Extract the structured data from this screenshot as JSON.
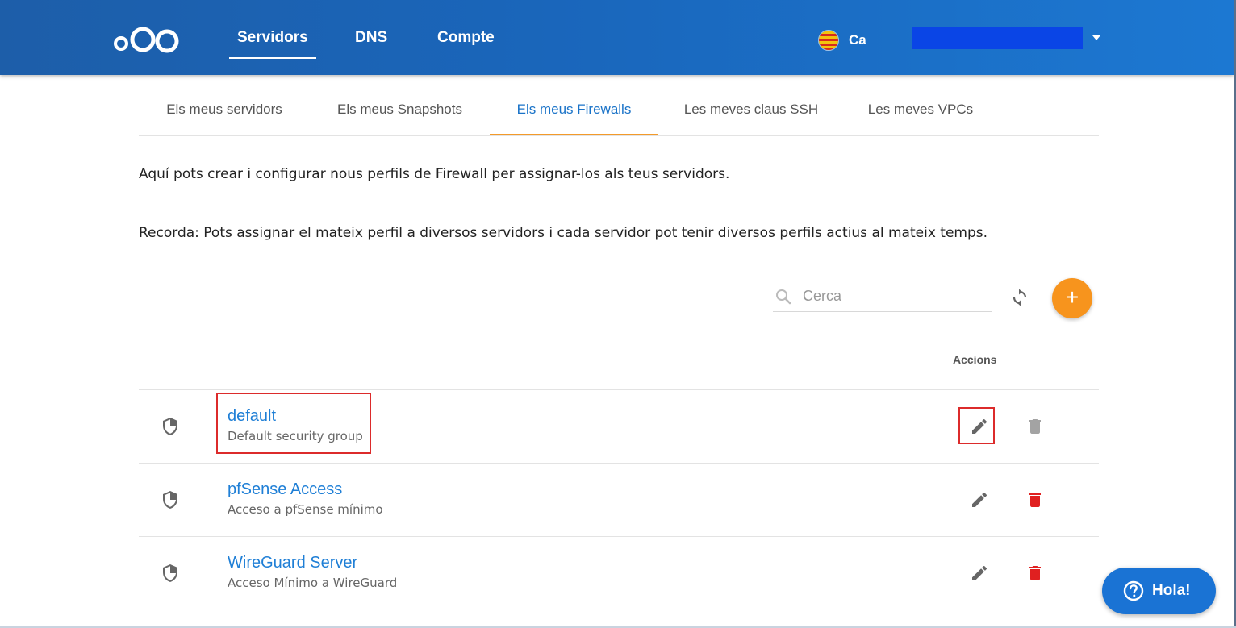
{
  "header": {
    "nav": [
      "Servidors",
      "DNS",
      "Compte"
    ],
    "language": "Ca",
    "colors": {
      "bar": "#1a66bb",
      "user_redaction": "#0a45e6"
    }
  },
  "tabs": [
    "Els meus servidors",
    "Els meus Snapshots",
    "Els meus Firewalls",
    "Les meves claus SSH",
    "Les meves VPCs"
  ],
  "active_tab": "Els meus Firewalls",
  "intro": {
    "line1": "Aquí pots crear i configurar nous perfils de Firewall per assignar-los als teus servidors.",
    "line2": "Recorda: Pots assignar el mateix perfil a diversos servidors i cada servidor pot tenir diversos perfils actius al mateix temps."
  },
  "search": {
    "placeholder": "Cerca",
    "value": ""
  },
  "table": {
    "actions_header": "Accions",
    "rows": [
      {
        "name": "default",
        "description": "Default security group",
        "delete_enabled": false
      },
      {
        "name": "pfSense Access",
        "description": "Acceso a pfSense mínimo",
        "delete_enabled": true
      },
      {
        "name": "WireGuard Server",
        "description": "Acceso Mínimo a WireGuard",
        "delete_enabled": true
      }
    ]
  },
  "chat": {
    "label": "Hola!"
  },
  "icons": {
    "logo": "nextcloud-logo",
    "flag": "catalan-flag-icon",
    "caret": "caret-down-icon",
    "search": "search-icon",
    "refresh": "refresh-icon",
    "add": "plus-icon",
    "shield": "shield-icon",
    "edit": "pencil-icon",
    "delete": "trash-icon",
    "help": "question-circle-icon"
  },
  "colors": {
    "accent": "#f7941d",
    "link": "#1f7fd6",
    "delete_active": "#e02020",
    "delete_disabled": "#9e9e9e",
    "highlight": "#dc2b2b"
  }
}
